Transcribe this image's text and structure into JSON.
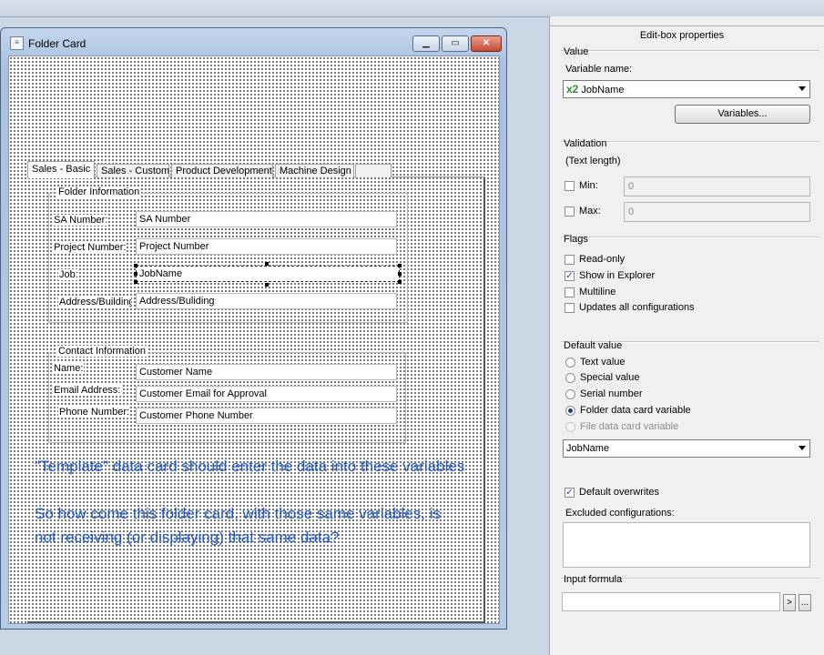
{
  "window": {
    "title": "Folder Card",
    "min_glyph": "▁",
    "max_glyph": "▭",
    "close_glyph": "✕"
  },
  "tabs": [
    "Sales - Basic",
    "Sales - Custom",
    "Product Development",
    "Machine Design"
  ],
  "folder_info": {
    "title": "Folder Information",
    "rows": [
      {
        "label": "SA Number:",
        "value": "SA Number"
      },
      {
        "label": "Project Number:",
        "value": "Project Number"
      },
      {
        "label": "Job:",
        "value": "JobName"
      },
      {
        "label": "Address/Building",
        "value": "Address/Buliding"
      }
    ]
  },
  "contact_info": {
    "title": "Contact Information",
    "rows": [
      {
        "label": "Name:",
        "value": "Customer Name"
      },
      {
        "label": "Email Address:",
        "value": "Customer Email for Approval"
      },
      {
        "label": "Phone Number:",
        "value": "Customer Phone Number"
      }
    ]
  },
  "annotation": {
    "line1": "\"Template\" data card should enter the data into these variables",
    "line2": "So how come this folder card, with those same variables, is",
    "line3": "not receiving (or displaying) that same data?"
  },
  "properties": {
    "title": "Edit-box properties",
    "value_section": "Value",
    "variable_name_label": "Variable name:",
    "variable_prefix": "x2",
    "variable_name": "JobName",
    "variables_button": "Variables...",
    "validation_section": "Validation",
    "text_length": "(Text length)",
    "min_label": "Min:",
    "min_value": "0",
    "max_label": "Max:",
    "max_value": "0",
    "flags_section": "Flags",
    "flags": [
      {
        "label": "Read-only",
        "checked": false
      },
      {
        "label": "Show in Explorer",
        "checked": true
      },
      {
        "label": "Multiline",
        "checked": false
      },
      {
        "label": "Updates all configurations",
        "checked": false
      }
    ],
    "default_section": "Default value",
    "default_options": [
      {
        "label": "Text value",
        "selected": false,
        "disabled": false
      },
      {
        "label": "Special value",
        "selected": false,
        "disabled": false
      },
      {
        "label": "Serial number",
        "selected": false,
        "disabled": false
      },
      {
        "label": "Folder data card variable",
        "selected": true,
        "disabled": false
      },
      {
        "label": "File data card variable",
        "selected": false,
        "disabled": true
      }
    ],
    "default_variable": "JobName",
    "default_overwrites_label": "Default overwrites",
    "default_overwrites_checked": true,
    "excluded_label": "Excluded configurations:",
    "input_formula_section": "Input formula",
    "formula_value": "",
    "formula_btn1": ">",
    "formula_btn2": "..."
  }
}
